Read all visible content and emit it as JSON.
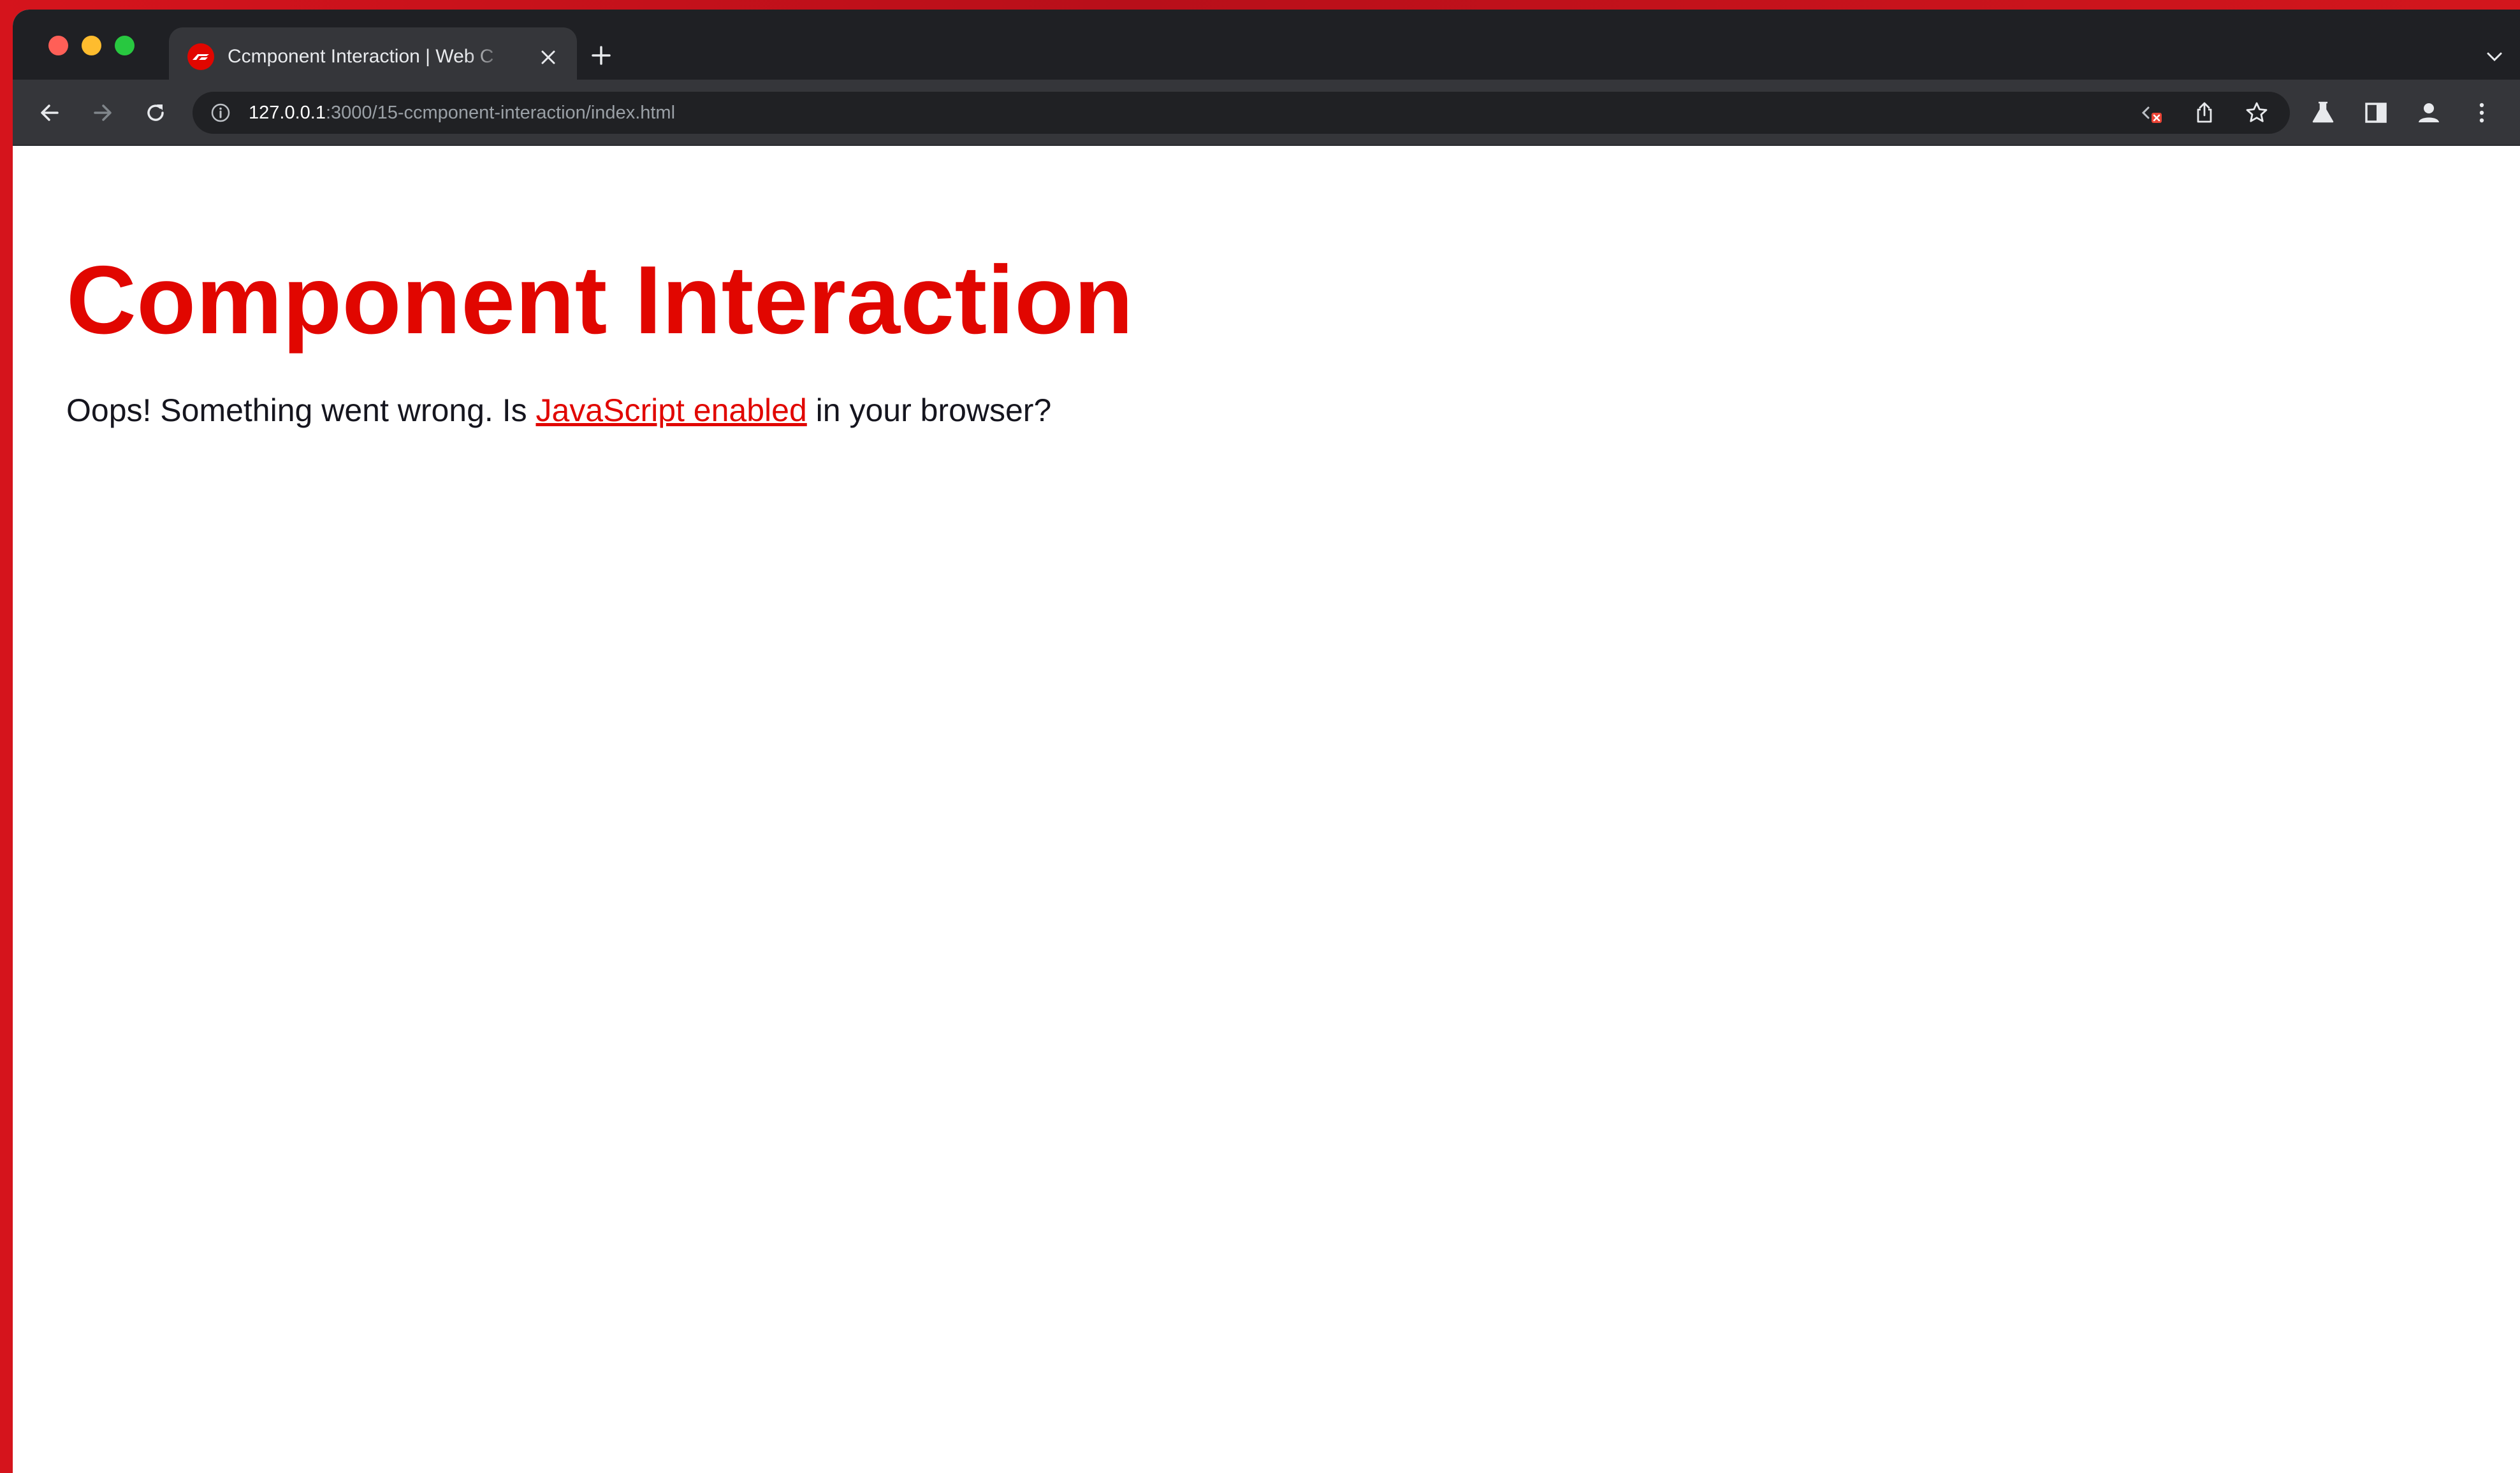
{
  "browser": {
    "tab": {
      "title": "Ccmponent Interaction | Web C"
    },
    "address_bar": {
      "host": "127.0.0.1",
      "path": ":3000/15-ccmponent-interaction/index.html"
    },
    "icons": {
      "back": "arrow-left-icon",
      "forward": "arrow-right-icon",
      "reload": "reload-icon",
      "site_info": "info-icon",
      "code_blocked": "code-blocked-icon",
      "share": "share-icon",
      "bookmark": "star-icon",
      "labs": "flask-icon",
      "side_panel": "side-panel-icon",
      "profile": "profile-icon",
      "menu": "kebab-menu-icon"
    }
  },
  "page": {
    "heading": "Component Interaction",
    "message_before": "Oops! Something went wrong. Is ",
    "message_link": "JavaScript enabled",
    "message_after": " in your browser?"
  },
  "colors": {
    "brand_red": "#e10600",
    "frame_red": "#d5141c",
    "chrome_dark": "#1f2024",
    "toolbar": "#35363a",
    "omnibox": "#202124",
    "text_dark": "#15151e"
  }
}
